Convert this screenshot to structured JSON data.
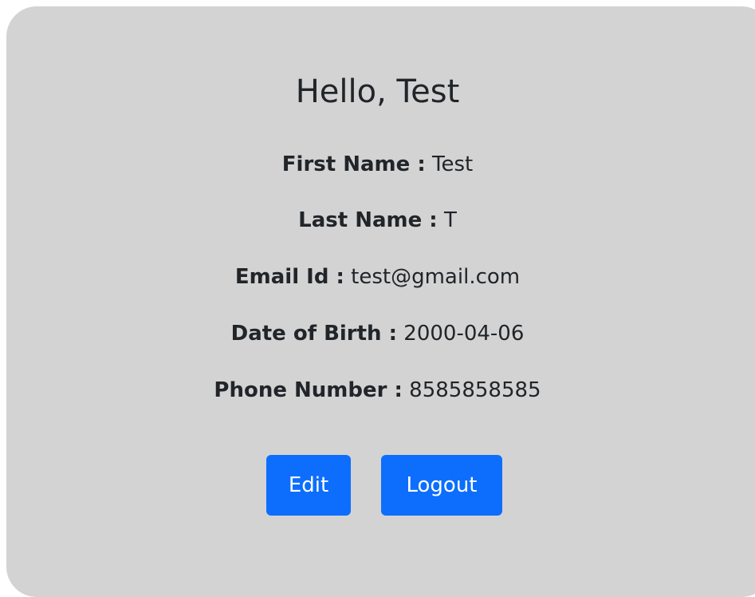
{
  "greeting": "Hello, Test",
  "fields": [
    {
      "label": "First Name :",
      "value": "Test"
    },
    {
      "label": "Last Name :",
      "value": "T"
    },
    {
      "label": "Email Id :",
      "value": "test@gmail.com"
    },
    {
      "label": "Date of Birth :",
      "value": "2000-04-06"
    },
    {
      "label": "Phone Number :",
      "value": "8585858585"
    }
  ],
  "buttons": {
    "edit": "Edit",
    "logout": "Logout"
  },
  "colors": {
    "card_background": "#d3d3d3",
    "button_primary": "#0d6efd",
    "text": "#212529"
  }
}
